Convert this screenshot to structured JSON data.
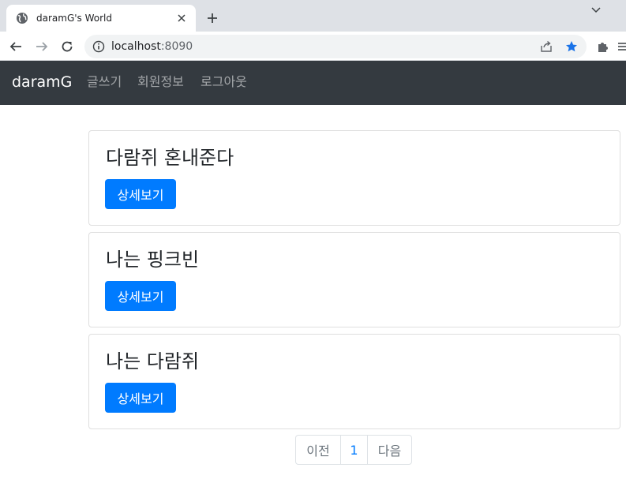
{
  "browser": {
    "tab_title": "daramG's World",
    "url_host": "localhost",
    "url_port": ":8090"
  },
  "navbar": {
    "brand": "daramG",
    "links": [
      "글쓰기",
      "회원정보",
      "로그아웃"
    ]
  },
  "posts": [
    {
      "title": "다람쥐 혼내준다",
      "button": "상세보기"
    },
    {
      "title": "나는 핑크빈",
      "button": "상세보기"
    },
    {
      "title": "나는 다람쥐",
      "button": "상세보기"
    }
  ],
  "pagination": {
    "prev": "이전",
    "current": "1",
    "next": "다음"
  },
  "colors": {
    "navbar_bg": "#343a40",
    "primary": "#007bff",
    "star": "#1a73e8"
  }
}
